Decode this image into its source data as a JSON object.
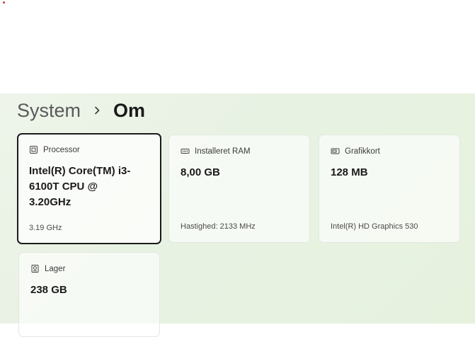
{
  "breadcrumb": {
    "parent": "System",
    "current": "Om"
  },
  "specs": [
    {
      "icon": "processor-icon",
      "label": "Processor",
      "value": "Intel(R) Core(TM) i3-6100T CPU @ 3.20GHz",
      "detail": "3.19 GHz",
      "selected": true
    },
    {
      "icon": "ram-icon",
      "label": "Installeret RAM",
      "value": "8,00 GB",
      "detail": "Hastighed: 2133 MHz"
    },
    {
      "icon": "graphics-card-icon",
      "label": "Grafikkort",
      "value": "128 MB",
      "detail": "Intel(R) HD Graphics 530"
    },
    {
      "icon": "storage-icon",
      "label": "Lager",
      "value": "238 GB",
      "detail": ""
    }
  ],
  "colors": {
    "background": "#e8f2e3",
    "card": "#ffffff",
    "selected_border": "#1b1b1b",
    "notification_dot": "#d13438"
  }
}
